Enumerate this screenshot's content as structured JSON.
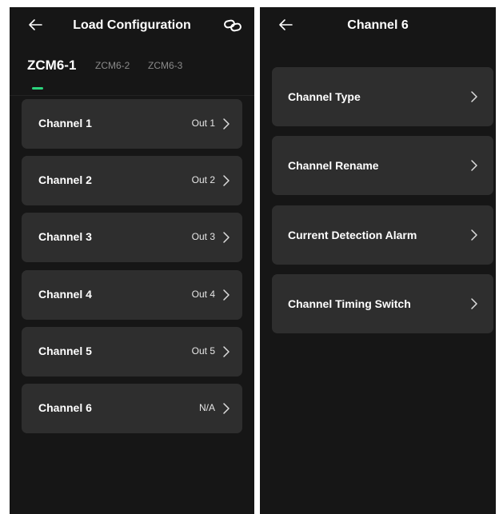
{
  "left": {
    "title": "Load Configuration",
    "tabs": [
      {
        "label": "ZCM6-1",
        "active": true
      },
      {
        "label": "ZCM6-2",
        "active": false
      },
      {
        "label": "ZCM6-3",
        "active": false
      }
    ],
    "channels": [
      {
        "label": "Channel 1",
        "value": "Out 1"
      },
      {
        "label": "Channel 2",
        "value": "Out 2"
      },
      {
        "label": "Channel 3",
        "value": "Out 3"
      },
      {
        "label": "Channel 4",
        "value": "Out 4"
      },
      {
        "label": "Channel 5",
        "value": "Out 5"
      },
      {
        "label": "Channel 6",
        "value": "N/A"
      }
    ],
    "icons": {
      "back": "arrow-left-icon",
      "link": "link-icon",
      "chevron": "chevron-right-icon"
    }
  },
  "right": {
    "title": "Channel 6",
    "items": [
      {
        "label": "Channel Type"
      },
      {
        "label": "Channel Rename"
      },
      {
        "label": "Current Detection Alarm"
      },
      {
        "label": "Channel Timing Switch"
      }
    ]
  },
  "colors": {
    "background": "#161616",
    "card": "#2e2e2e",
    "accent": "#2bd47d",
    "inactive_tab": "#8a8a8a"
  }
}
